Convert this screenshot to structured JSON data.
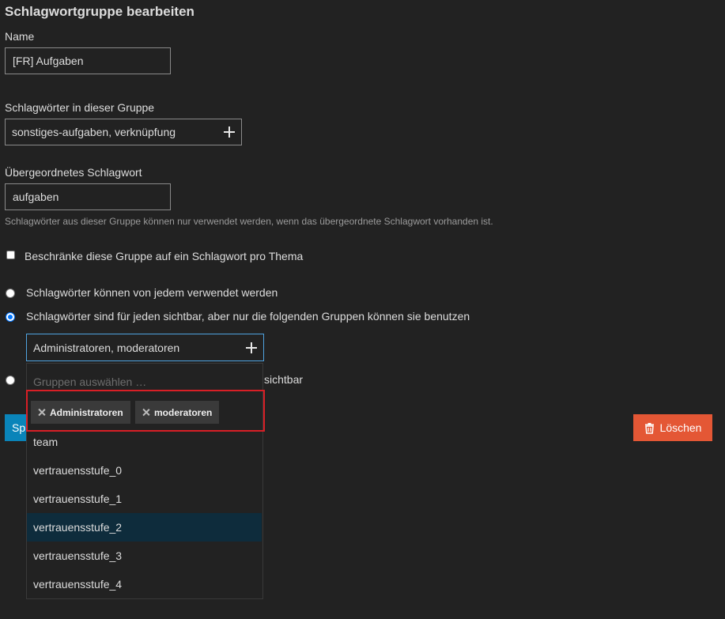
{
  "page": {
    "title": "Schlagwortgruppe bearbeiten"
  },
  "name_field": {
    "label": "Name",
    "value": "[FR] Aufgaben"
  },
  "tags_field": {
    "label": "Schlagwörter in dieser Gruppe",
    "value": "sonstiges-aufgaben, verknüpfung"
  },
  "parent_field": {
    "label": "Übergeordnetes Schlagwort",
    "value": "aufgaben",
    "hint": "Schlagwörter aus dieser Gruppe können nur verwendet werden, wenn das übergeordnete Schlagwort vorhanden ist."
  },
  "one_per_topic": {
    "label": "Beschränke diese Gruppe auf ein Schlagwort pro Thema",
    "checked": false
  },
  "permissions": {
    "option_everyone": "Schlagwörter können von jedem verwendet werden",
    "option_visible_groups": "Schlagwörter sind für jeden sichtbar, aber nur die folgenden Gruppen können sie benutzen",
    "option_hidden_tail": "sichtbar",
    "selected": "option_visible_groups"
  },
  "group_chooser": {
    "value": "Administratoren, moderatoren",
    "filter_placeholder": "Gruppen auswählen …",
    "selected_chips": [
      "Administratoren",
      "moderatoren"
    ],
    "options": [
      "team",
      "vertrauensstufe_0",
      "vertrauensstufe_1",
      "vertrauensstufe_2",
      "vertrauensstufe_3",
      "vertrauensstufe_4"
    ],
    "highlighted": "vertrauensstufe_2"
  },
  "actions": {
    "save_label_partial": "Sp",
    "delete_label": "Löschen"
  },
  "colors": {
    "background": "#222222",
    "primary": "#0a84b9",
    "danger": "#e45735",
    "highlight": "#0e2c3c",
    "annotation_red": "#d81f26"
  }
}
